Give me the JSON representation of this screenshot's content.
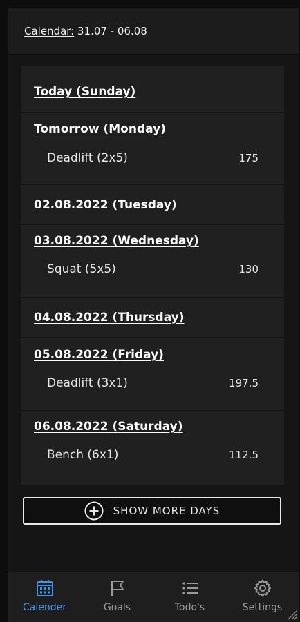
{
  "header": {
    "label": "Calendar:",
    "range": " 31.07 - 06.08"
  },
  "days": [
    {
      "title": "Today (Sunday)",
      "exercises": []
    },
    {
      "title": "Tomorrow (Monday)",
      "exercises": [
        {
          "name": "Deadlift (2x5)",
          "weight": "175"
        }
      ]
    },
    {
      "title": "02.08.2022 (Tuesday)",
      "exercises": []
    },
    {
      "title": "03.08.2022 (Wednesday)",
      "exercises": [
        {
          "name": "Squat (5x5)",
          "weight": "130"
        }
      ]
    },
    {
      "title": "04.08.2022 (Thursday)",
      "exercises": []
    },
    {
      "title": "05.08.2022 (Friday)",
      "exercises": [
        {
          "name": "Deadlift (3x1)",
          "weight": "197.5"
        }
      ]
    },
    {
      "title": "06.08.2022 (Saturday)",
      "exercises": [
        {
          "name": "Bench (6x1)",
          "weight": "112.5"
        }
      ]
    }
  ],
  "show_more": {
    "label": "SHOW MORE DAYS",
    "icon": "plus-circle-icon"
  },
  "nav": {
    "items": [
      {
        "label": "Calender",
        "icon": "calendar-icon",
        "active": true
      },
      {
        "label": "Goals",
        "icon": "flag-icon",
        "active": false
      },
      {
        "label": "Todo's",
        "icon": "list-icon",
        "active": false
      },
      {
        "label": "Settings",
        "icon": "gear-icon",
        "active": false
      }
    ],
    "active_color": "#4a90e2",
    "inactive_color": "#9a9a9a"
  }
}
